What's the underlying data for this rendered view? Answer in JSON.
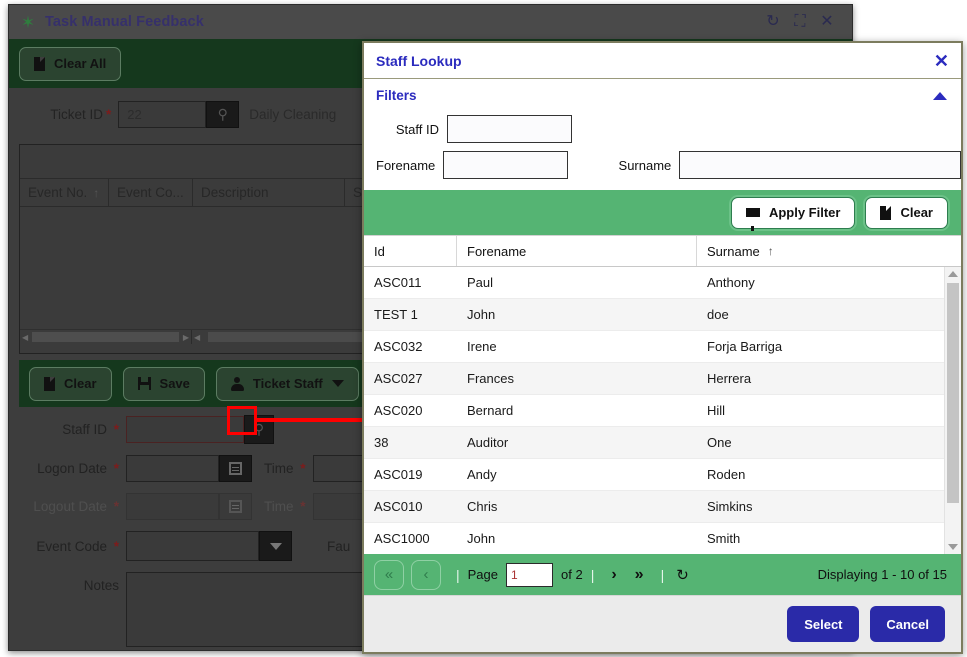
{
  "background_window": {
    "title": "Task Manual Feedback",
    "title_icon": "gear-icon",
    "titlebar_actions": [
      {
        "name": "refresh-icon",
        "glyph": "↻"
      },
      {
        "name": "maximize-icon",
        "glyph": "⛶"
      },
      {
        "name": "close-icon",
        "glyph": "✕"
      }
    ],
    "toolbar": {
      "clear_all_label": "Clear All"
    },
    "ticket": {
      "label": "Ticket ID",
      "required_mark": "*",
      "value": "22",
      "search_icon": "search-icon",
      "description": "Daily Cleaning"
    },
    "grid": {
      "columns": [
        "Event No.",
        "Event Co...",
        "Description",
        "Staff"
      ],
      "sort_column": "Event No.",
      "sort_direction": "asc",
      "rows": []
    },
    "toolbar2": {
      "clear_label": "Clear",
      "save_label": "Save",
      "ticket_staff_label": "Ticket Staff"
    },
    "form": {
      "staff_id_label": "Staff ID",
      "staff_id_value": "",
      "logon_date_label": "Logon Date",
      "logon_date_value": "",
      "logon_time_label": "Time",
      "logon_time_value": "",
      "logout_date_label": "Logout Date",
      "logout_date_value": "",
      "logout_time_label": "Time",
      "logout_time_value": "",
      "event_code_label": "Event Code",
      "event_code_value": "",
      "fault_label": "Fau",
      "notes_label": "Notes",
      "notes_value": "",
      "required_mark": "*"
    }
  },
  "modal": {
    "title": "Staff Lookup",
    "close_glyph": "✕",
    "filters": {
      "heading": "Filters",
      "staff_id": {
        "label": "Staff ID",
        "value": "",
        "placeholder": ""
      },
      "forename": {
        "label": "Forename",
        "value": "",
        "placeholder": ""
      },
      "surname": {
        "label": "Surname",
        "value": "",
        "placeholder": ""
      },
      "apply_filter_label": "Apply Filter",
      "clear_label": "Clear"
    },
    "grid": {
      "columns": [
        "Id",
        "Forename",
        "Surname"
      ],
      "sort_column": "Surname",
      "sort_glyph": "↑",
      "rows": [
        {
          "id": "ASC011",
          "forename": "Paul",
          "surname": "Anthony"
        },
        {
          "id": "TEST 1",
          "forename": "John",
          "surname": "doe"
        },
        {
          "id": "ASC032",
          "forename": "Irene",
          "surname": "Forja Barriga"
        },
        {
          "id": "ASC027",
          "forename": "Frances",
          "surname": "Herrera"
        },
        {
          "id": "ASC020",
          "forename": "Bernard",
          "surname": "Hill"
        },
        {
          "id": "38",
          "forename": "Auditor",
          "surname": "One"
        },
        {
          "id": "ASC019",
          "forename": "Andy",
          "surname": "Roden"
        },
        {
          "id": "ASC010",
          "forename": "Chris",
          "surname": "Simkins"
        },
        {
          "id": "ASC1000",
          "forename": "John",
          "surname": "Smith"
        }
      ]
    },
    "pager": {
      "first_glyph": "«",
      "prev_glyph": "‹",
      "page_label": "Page",
      "page_value": "1",
      "of_label": "of 2",
      "next_glyph": "›",
      "last_glyph": "»",
      "refresh_glyph": "↻",
      "status": "Displaying 1 - 10 of 15",
      "separator": "|"
    },
    "footer": {
      "select_label": "Select",
      "cancel_label": "Cancel"
    }
  },
  "colors": {
    "modal_accent": "#2b2bbe",
    "green_bar": "#55b473",
    "dark_green_toolbar": "#15381d",
    "blue_button": "#2a2aa8",
    "highlight_red": "#ff0000"
  }
}
